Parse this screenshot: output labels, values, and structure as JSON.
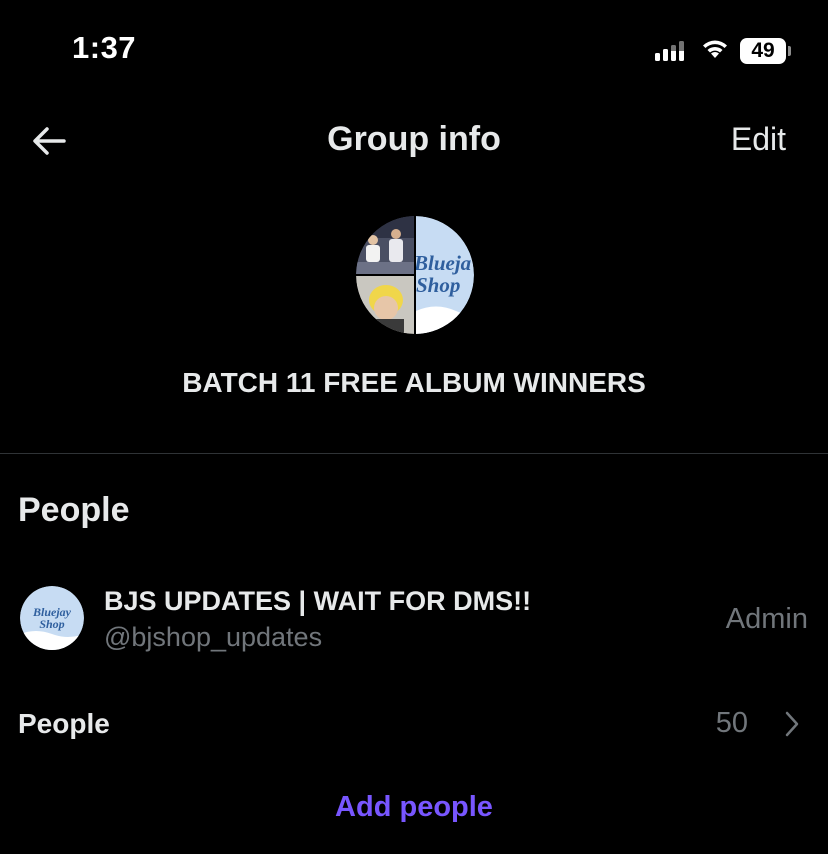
{
  "status_bar": {
    "time": "1:37",
    "battery": "49"
  },
  "header": {
    "title": "Group info",
    "edit_label": "Edit"
  },
  "group": {
    "name": "BATCH 11 FREE ALBUM WINNERS",
    "avatar_text": [
      "Blueja",
      "Shop"
    ]
  },
  "people_section": {
    "title": "People",
    "members": [
      {
        "name": "BJS UPDATES | WAIT FOR DMS!!",
        "handle": "@bjshop_updates",
        "role": "Admin",
        "avatar_text": [
          "Bluejay",
          "Shop"
        ]
      }
    ],
    "people_row": {
      "label": "People",
      "count": "50"
    },
    "add_label": "Add people"
  },
  "colors": {
    "background": "#000000",
    "accent": "#7856ff",
    "muted": "#71767b",
    "divider": "#2f3336"
  }
}
